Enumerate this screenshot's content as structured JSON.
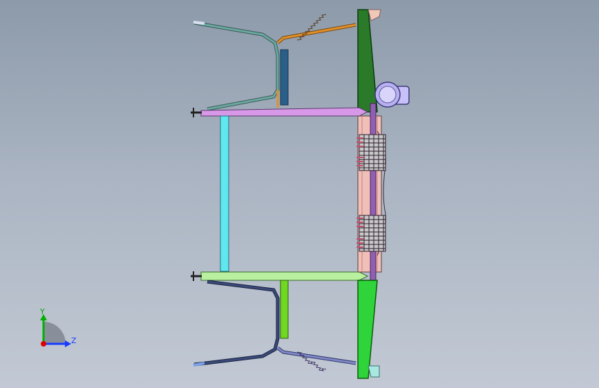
{
  "window": {
    "background_top": "#8c9aaa",
    "background_bottom": "#c2c9d4"
  },
  "triad": {
    "y_label": "Y",
    "z_label": "Z",
    "colors": {
      "y": "#00b000",
      "z": "#1a3cff",
      "x": "#e00000"
    }
  },
  "model_colors": {
    "upper_plate": "#2a7a2a",
    "lower_plate": "#2fd43a",
    "upper_arm": "#d898e8",
    "lower_arm": "#b8f0a0",
    "vertical_post": "#60e8f0",
    "upper_frame": "#5a9088",
    "upper_frame_inner": "#e0902a",
    "lower_frame": "#3a4a78",
    "lower_frame_inner": "#8088c8",
    "upper_block": "#2a6088",
    "lower_block": "#70d820",
    "gear": "#c8c8c8",
    "gear_outline": "#2a1a2a",
    "spring": "#c05070",
    "hub": "#b8b0f0",
    "shaft": "#9060b0",
    "column": "#f0c0b8",
    "tab_top": "#f0c8b8",
    "tab_bottom": "#a8e8e0"
  }
}
